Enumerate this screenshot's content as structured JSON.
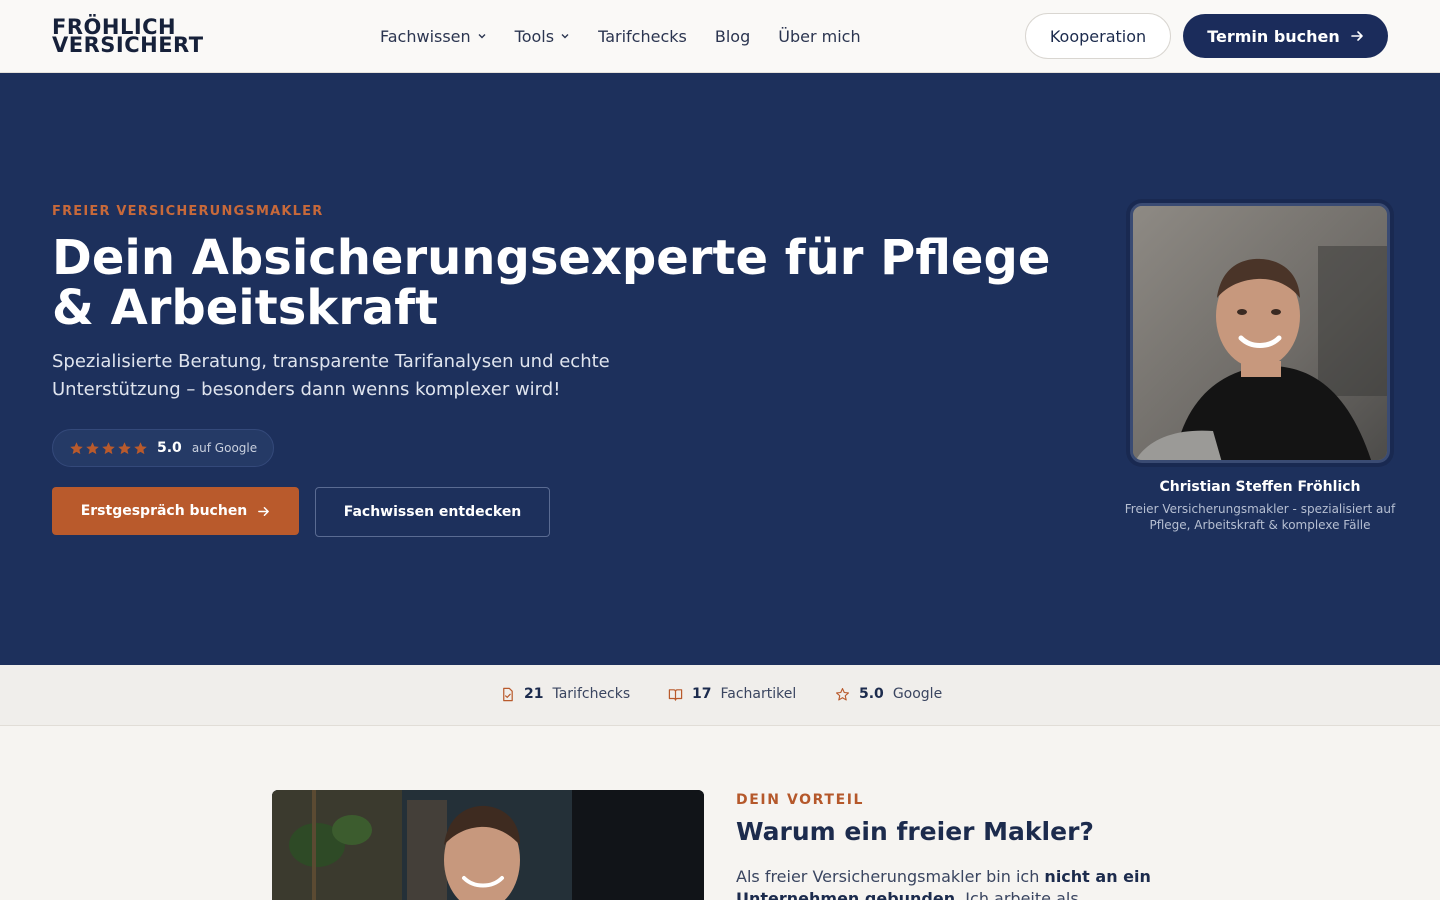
{
  "header": {
    "logo_line1": "FRÖHLICH",
    "logo_line2": "VERSICHERT",
    "nav": [
      {
        "label": "Fachwissen",
        "has_dropdown": true
      },
      {
        "label": "Tools",
        "has_dropdown": true
      },
      {
        "label": "Tarifchecks",
        "has_dropdown": false
      },
      {
        "label": "Blog",
        "has_dropdown": false
      },
      {
        "label": "Über mich",
        "has_dropdown": false
      }
    ],
    "kooperation_label": "Kooperation",
    "termin_label": "Termin buchen"
  },
  "hero": {
    "eyebrow": "FREIER VERSICHERUNGSMAKLER",
    "title": "Dein Absicherungsexperte für Pflege & Arbeitskraft",
    "subtitle": "Spezialisierte Beratung, transparente Tarifanalysen und echte Unterstützung – besonders dann wenns komplexer wird!",
    "rating": {
      "stars": 5,
      "value": "5.0",
      "source": "auf Google"
    },
    "primary_cta": "Erstgespräch buchen",
    "secondary_cta": "Fachwissen entdecken",
    "person": {
      "name": "Christian Steffen Fröhlich",
      "role": "Freier Versicherungsmakler - spezialisiert auf Pflege, Arbeitskraft & komplexe Fälle"
    }
  },
  "stats": [
    {
      "icon": "document-check-icon",
      "number": "21",
      "label": "Tarifchecks"
    },
    {
      "icon": "open-book-icon",
      "number": "17",
      "label": "Fachartikel"
    },
    {
      "icon": "star-outline-icon",
      "number": "5.0",
      "label": "Google"
    }
  ],
  "section": {
    "eyebrow": "DEIN VORTEIL",
    "title": "Warum ein freier Makler?",
    "text_before": "Als freier Versicherungsmakler bin ich ",
    "text_bold": "nicht an ein Unternehmen gebunden",
    "text_after": ". Ich arbeite als"
  },
  "colors": {
    "navy": "#1d305c",
    "button_navy": "#1b2c5b",
    "accent_orange": "#b95a2c",
    "background": "#f6f4f1"
  }
}
